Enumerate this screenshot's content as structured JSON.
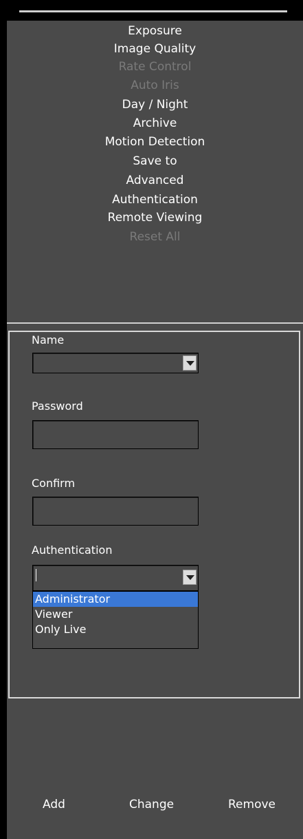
{
  "menu": {
    "items": [
      {
        "label": "Exposure",
        "enabled": true
      },
      {
        "label": "Image Quality",
        "enabled": true
      },
      {
        "label": "Rate Control",
        "enabled": false
      },
      {
        "label": "Auto Iris",
        "enabled": false
      },
      {
        "label": "Day / Night",
        "enabled": true
      },
      {
        "label": "Archive",
        "enabled": true
      },
      {
        "label": "Motion Detection",
        "enabled": true
      },
      {
        "label": "Save to",
        "enabled": true
      },
      {
        "label": "Advanced",
        "enabled": true
      },
      {
        "label": "Authentication",
        "enabled": true
      },
      {
        "label": "Remote Viewing",
        "enabled": true
      },
      {
        "label": "Reset All",
        "enabled": false
      }
    ]
  },
  "form": {
    "name_label": "Name",
    "name_value": "",
    "password_label": "Password",
    "password_value": "",
    "confirm_label": "Confirm",
    "confirm_value": "",
    "auth_label": "Authentication",
    "auth_value": "",
    "auth_options": [
      "Administrator",
      "Viewer",
      "Only Live"
    ],
    "auth_highlighted": "Administrator"
  },
  "footer": {
    "add": "Add",
    "change": "Change",
    "remove": "Remove"
  },
  "colors": {
    "panel_bg": "#4a4a4a",
    "selection": "#3a78d6",
    "disabled_text": "#7a7a7a"
  }
}
